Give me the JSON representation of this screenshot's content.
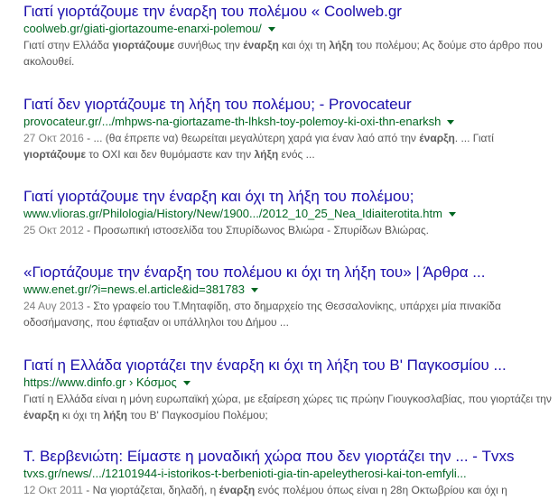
{
  "results": [
    {
      "title": "Γιατί γιορτάζουμε την έναρξη του πολέμου « Coolweb.gr",
      "url": "coolweb.gr/giati-giortazoume-enarxi-polemou/",
      "date": "",
      "snippet": [
        {
          "t": "Γιατί στην Ελλάδα "
        },
        {
          "t": "γιορτάζουμε",
          "b": true
        },
        {
          "t": " συνήθως την "
        },
        {
          "t": "έναρξη",
          "b": true
        },
        {
          "t": " και όχι τη "
        },
        {
          "t": "λήξη",
          "b": true
        },
        {
          "t": " του πολέμου; Ας δούμε στο άρθρο που ακολουθεί."
        }
      ]
    },
    {
      "title": "Γιατί δεν γιορτάζουμε τη λήξη του πολέμου; - Provocateur",
      "url": "provocateur.gr/.../mhpws-na-giortazame-th-lhksh-toy-polemoy-ki-oxi-thn-enarksh",
      "date": "27 Οκτ 2016",
      "snippet": [
        {
          "t": " - ... (θα έπρεπε να) θεωρείται μεγαλύτερη χαρά για έναν λαό από την "
        },
        {
          "t": "έναρξη",
          "b": true
        },
        {
          "t": ". ... Γιατί "
        },
        {
          "t": "γιορτάζουμε",
          "b": true
        },
        {
          "t": " το ΟΧΙ και δεν θυμόμαστε καν την "
        },
        {
          "t": "λήξη",
          "b": true
        },
        {
          "t": " ενός ..."
        }
      ]
    },
    {
      "title": "Γιατί γιορτάζουμε την έναρξη και όχι τη λήξη του πολέμου;",
      "url": "www.vlioras.gr/Philologia/History/New/1900.../2012_10_25_Nea_Idiaiterotita.htm",
      "date": "25 Οκτ 2012",
      "snippet": [
        {
          "t": " - Προσωπική ιστοσελίδα του Σπυρίδωνος Βλιώρα - Σπυρίδων Βλιώρας."
        }
      ]
    },
    {
      "title": "«Γιορτάζουμε την έναρξη του πολέμου κι όχι τη λήξη του» | Άρθρα ...",
      "url": "www.enet.gr/?i=news.el.article&id=381783",
      "date": "24 Αυγ 2013",
      "snippet": [
        {
          "t": " - Στο γραφείο του Τ.Μηταφίδη, στο δημαρχείο της Θεσσαλονίκης, υπάρχει μία πινακίδα οδοσήμανσης, που έφτιαξαν οι υπάλληλοι του Δήμου ..."
        }
      ]
    },
    {
      "title": "Γιατί η Ελλάδα γιορτάζει την έναρξη κι όχι τη λήξη του Β' Παγκοσμίου ...",
      "url": "https://www.dinfo.gr › Κόσμος",
      "date": "",
      "snippet": [
        {
          "t": "Γιατί η Ελλάδα είναι η μόνη ευρωπαϊκή χώρα, με εξαίρεση χώρες τις πρώην Γιουγκοσλαβίας, που γιορτάζει την "
        },
        {
          "t": "έναρξη",
          "b": true
        },
        {
          "t": " κι όχι τη "
        },
        {
          "t": "λήξη",
          "b": true
        },
        {
          "t": " του Β' Παγκοσμίου Πολέμου;"
        }
      ]
    },
    {
      "title": "Τ. Βερβενιώτη: Είμαστε η μοναδική χώρα που δεν γιορτάζει την ... - Tvxs",
      "url": "tvxs.gr/news/.../12101944-i-istorikos-t-berbenioti-gia-tin-apeleytherosi-kai-ton-emfyli...",
      "date": "12 Οκτ 2011",
      "snippet": [
        {
          "t": " - Να γιορτάζεται, δηλαδή, η "
        },
        {
          "t": "έναρξη",
          "b": true
        },
        {
          "t": " ενός πολέμου όπως είναι η 28η Οκτωβρίου και όχι η"
        }
      ]
    }
  ]
}
